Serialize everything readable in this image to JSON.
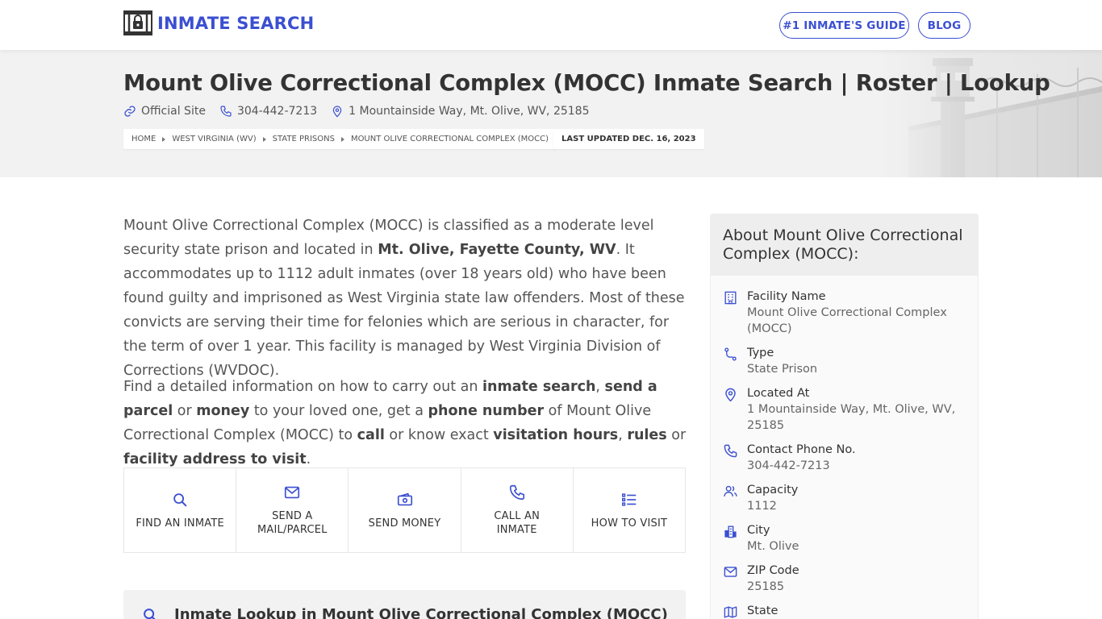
{
  "header": {
    "logo_text": "INMATE SEARCH",
    "nav": {
      "guide_label": "#1 INMATE'S GUIDE",
      "blog_label": "BLOG"
    }
  },
  "hero": {
    "title": "Mount Olive Correctional Complex (MOCC) Inmate Search | Roster | Lookup",
    "official_site": "Official Site",
    "phone": "304-442-7213",
    "address": "1 Mountainside Way, Mt. Olive, WV, 25185",
    "breadcrumb": [
      "HOME",
      "WEST VIRGINIA (WV)",
      "STATE PRISONS",
      "MOUNT OLIVE CORRECTIONAL COMPLEX (MOCC)"
    ],
    "last_updated": "LAST UPDATED DEC. 16, 2023"
  },
  "intro": {
    "p1_a": "Mount Olive Correctional Complex (MOCC) is classified as a moderate level security state prison and located in ",
    "p1_b": "Mt. Olive, Fayette County, WV",
    "p1_c": ". It accommodates up to 1112 adult inmates (over 18 years old) who have been found guilty and imprisoned as West Virginia state law offenders. Most of these convicts are serving their time for felonies which are serious in character, for the term of over 1 year. This facility is managed by West Virginia Division of Corrections (WVDOC).",
    "p2_a": "Find a detailed information on how to carry out an ",
    "p2_b": "inmate search",
    "p2_c": ", ",
    "p2_d": "send a parcel",
    "p2_e": " or ",
    "p2_f": "money",
    "p2_g": " to your loved one, get a ",
    "p2_h": "phone number",
    "p2_i": " of Mount Olive Correctional Complex (MOCC) to ",
    "p2_j": "call",
    "p2_k": " or know exact ",
    "p2_l": "visitation hours",
    "p2_m": ", ",
    "p2_n": "rules",
    "p2_o": " or ",
    "p2_p": "facility address to visit",
    "p2_q": "."
  },
  "actions": [
    {
      "label": "FIND AN INMATE",
      "icon": "search-icon"
    },
    {
      "label": "SEND A MAIL/PARCEL",
      "icon": "mail-icon"
    },
    {
      "label": "SEND MONEY",
      "icon": "money-icon"
    },
    {
      "label": "CALL AN INMATE",
      "icon": "phone-icon"
    },
    {
      "label": "HOW TO VISIT",
      "icon": "list-icon"
    }
  ],
  "lookup": {
    "title": "Inmate Lookup in Mount Olive Correctional Complex (MOCC)"
  },
  "sidebar": {
    "title": "About Mount Olive Correctional Complex (MOCC):",
    "facts": [
      {
        "label": "Facility Name",
        "value": "Mount Olive Correctional Complex (MOCC)",
        "icon": "building-icon"
      },
      {
        "label": "Type",
        "value": "State Prison",
        "icon": "route-icon"
      },
      {
        "label": "Located At",
        "value": "1 Mountainside Way, Mt. Olive, WV, 25185",
        "icon": "location-pin-icon"
      },
      {
        "label": "Contact Phone No.",
        "value": "304-442-7213",
        "icon": "phone-icon"
      },
      {
        "label": "Capacity",
        "value": "1112",
        "icon": "users-icon"
      },
      {
        "label": "City",
        "value": "Mt. Olive",
        "icon": "city-icon"
      },
      {
        "label": "ZIP Code",
        "value": "25185",
        "icon": "mail-icon"
      },
      {
        "label": "State",
        "value": "",
        "icon": "map-icon"
      }
    ]
  },
  "colors": {
    "brand": "#3b4fd1",
    "hero_bg": "#f2f2f2",
    "text": "#555555"
  }
}
